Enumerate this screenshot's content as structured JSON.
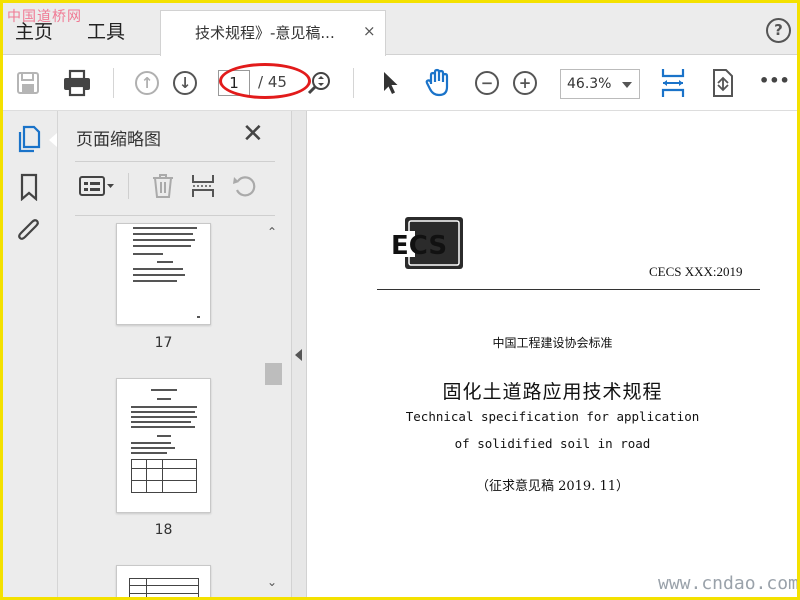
{
  "watermark_top": "中国道桥网",
  "watermark_bottom": "www.cndao.com",
  "menu": {
    "home": "主页",
    "tools": "工具"
  },
  "tab": {
    "title": "技术规程》-意见稿...",
    "close": "×"
  },
  "help": "?",
  "toolbar": {
    "current_page": "1",
    "total_pages": "/ 45",
    "zoom": "46.3%",
    "more": "•••",
    "highlight_color": "#e21b1b",
    "accent_color": "#1a73c9"
  },
  "sidebar": {
    "panel_title": "页面缩略图",
    "close": "✕",
    "icons": [
      "pages-icon",
      "bookmark-icon",
      "attachment-icon"
    ]
  },
  "thumbnails": [
    {
      "page": "17"
    },
    {
      "page": "18"
    }
  ],
  "document": {
    "code": "CECS XXX:2019",
    "logo_text": "ECS",
    "standard_type": "中国工程建设协会标准",
    "title_cn": "固化土道路应用技术规程",
    "title_en_line1": "Technical specification for application",
    "title_en_line2": "of solidified soil in road",
    "draft": "（征求意见稿 2019. 11）"
  }
}
